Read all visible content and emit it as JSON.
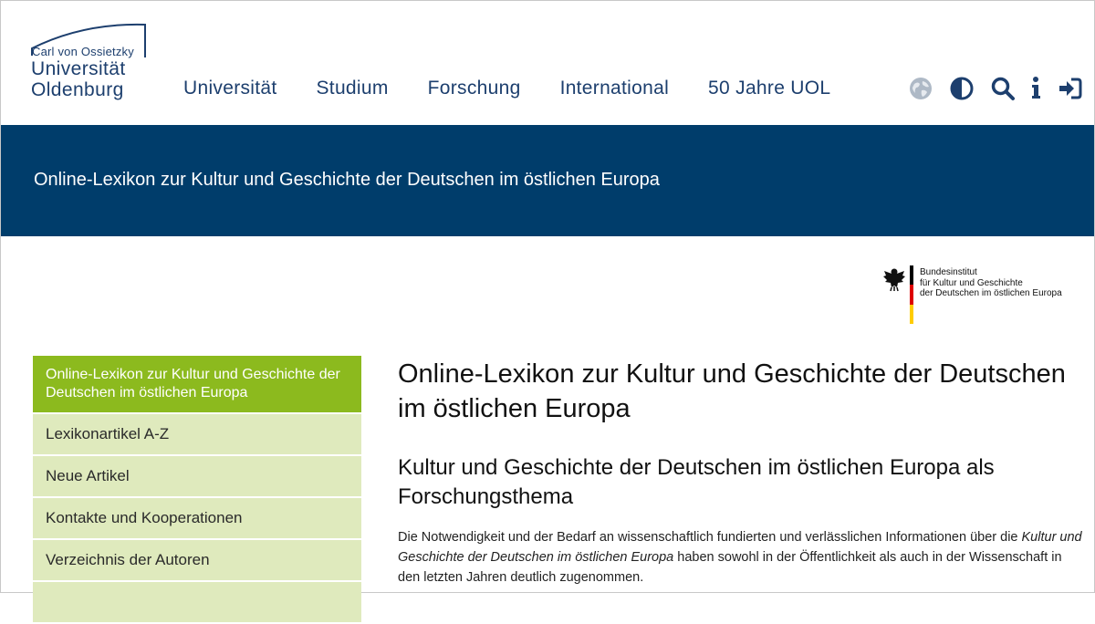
{
  "logo": {
    "line1": "Carl von Ossietzky",
    "line2": "Universität",
    "line3": "Oldenburg"
  },
  "nav": {
    "items": [
      "Universität",
      "Studium",
      "Forschung",
      "International",
      "50 Jahre UOL"
    ]
  },
  "tools": [
    "globe-icon",
    "contrast-icon",
    "search-icon",
    "info-icon",
    "login-icon"
  ],
  "banner": {
    "title": "Online-Lexikon zur Kultur und Geschichte der Deutschen im östlichen Europa"
  },
  "bki_logo": {
    "line1": "Bundesinstitut",
    "line2": "für Kultur und Geschichte",
    "line3": "der Deutschen im östlichen Europa",
    "flag_colors": [
      "#000000",
      "#dd0000",
      "#ffcc00"
    ]
  },
  "sidebar": {
    "items": [
      {
        "label": "Online-Lexikon zur Kultur und Geschichte der Deutschen im östlichen Europa",
        "active": true
      },
      {
        "label": "Lexikonartikel A-Z"
      },
      {
        "label": "Neue Artikel"
      },
      {
        "label": "Kontakte und Kooperationen"
      },
      {
        "label": "Verzeichnis der Autoren"
      },
      {
        "label": ""
      }
    ]
  },
  "main": {
    "title": "Online-Lexikon zur Kultur und Geschichte der Deutschen im östlichen Europa",
    "subtitle": "Kultur und Geschichte der Deutschen im östlichen Europa als Forschungsthema",
    "para": {
      "t1": "Die Notwendigkeit und der Bedarf an wissenschaftlich fundierten und verlässlichen Informationen über die ",
      "em1": "Kultur und Geschichte der Deutschen im östlichen Europa",
      "t2": " haben sowohl in der Öffentlichkeit als auch in der Wissenschaft in den letzten Jahren deutlich zugenommen."
    }
  },
  "colors": {
    "brand_blue": "#003d6b",
    "nav_text": "#1d3f6e",
    "sidebar_active": "#8cba1e",
    "sidebar_item": "#dfeabd"
  }
}
